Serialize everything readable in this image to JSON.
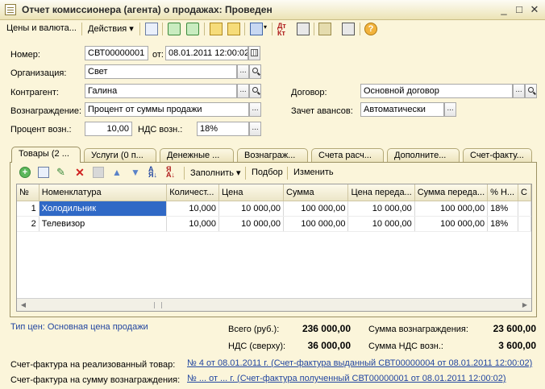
{
  "window": {
    "title": "Отчет комиссионера (агента) о продажах: Проведен",
    "controls": [
      "_",
      "□",
      "✕"
    ]
  },
  "toolbar": {
    "prices_menu": "Цены и валюта...",
    "actions_menu": "Действия ▾"
  },
  "header": {
    "number_label": "Номер:",
    "number_value": "СВТ00000001",
    "from_label": "от:",
    "date_value": "08.01.2011 12:00:02",
    "org_label": "Организация:",
    "org_value": "Свет",
    "contractor_label": "Контрагент:",
    "contractor_value": "Галина",
    "contract_label": "Договор:",
    "contract_value": "Основной договор",
    "reward_label": "Вознаграждение:",
    "reward_value": "Процент от суммы продажи",
    "advance_label": "Зачет авансов:",
    "advance_value": "Автоматически",
    "percent_label": "Процент возн.:",
    "percent_value": "10,00",
    "vat_label": "НДС возн.:",
    "vat_value": "18%"
  },
  "tabs": [
    {
      "label": "Товары (2 ..."
    },
    {
      "label": "Услуги (0 п..."
    },
    {
      "label": "Денежные ..."
    },
    {
      "label": "Вознаграж..."
    },
    {
      "label": "Счета расч..."
    },
    {
      "label": "Дополните..."
    },
    {
      "label": "Счет-факту..."
    }
  ],
  "panel_toolbar": {
    "fill_label": "Заполнить ▾",
    "select_label": "Подбор",
    "change_label": "Изменить"
  },
  "table": {
    "headers": [
      "№",
      "Номенклатура",
      "Количест...",
      "Цена",
      "Сумма",
      "Цена переда...",
      "Сумма переда...",
      "% Н...",
      "С"
    ],
    "rows": [
      {
        "n": "1",
        "name": "Холодильник",
        "qty": "10,000",
        "price": "10 000,00",
        "sum": "100 000,00",
        "tprice": "10 000,00",
        "tsum": "100 000,00",
        "vat": "18%"
      },
      {
        "n": "2",
        "name": "Телевизор",
        "qty": "10,000",
        "price": "10 000,00",
        "sum": "100 000,00",
        "tprice": "10 000,00",
        "tsum": "100 000,00",
        "vat": "18%"
      }
    ]
  },
  "footer": {
    "price_type": "Тип цен: Основная цена продажи",
    "total_label": "Всего (руб.):",
    "total_value": "236 000,00",
    "vat_label": "НДС (сверху):",
    "vat_value": "36 000,00",
    "reward_sum_label": "Сумма вознаграждения:",
    "reward_sum_value": "23 600,00",
    "reward_vat_label": "Сумма НДС возн.:",
    "reward_vat_value": "3 600,00",
    "invoice_goods_label": "Счет-фактура на реализованный товар:",
    "invoice_goods_link": "№ 4 от 08.01.2011 г. (Счет-фактура выданный СВТ00000004 от 08.01.2011 12:00:02)",
    "invoice_reward_label": "Счет-фактура на сумму вознаграждения:",
    "invoice_reward_link": "№ ... от ... г. (Счет-фактура полученный СВТ00000001 от 08.01.2011 12:00:02)"
  }
}
